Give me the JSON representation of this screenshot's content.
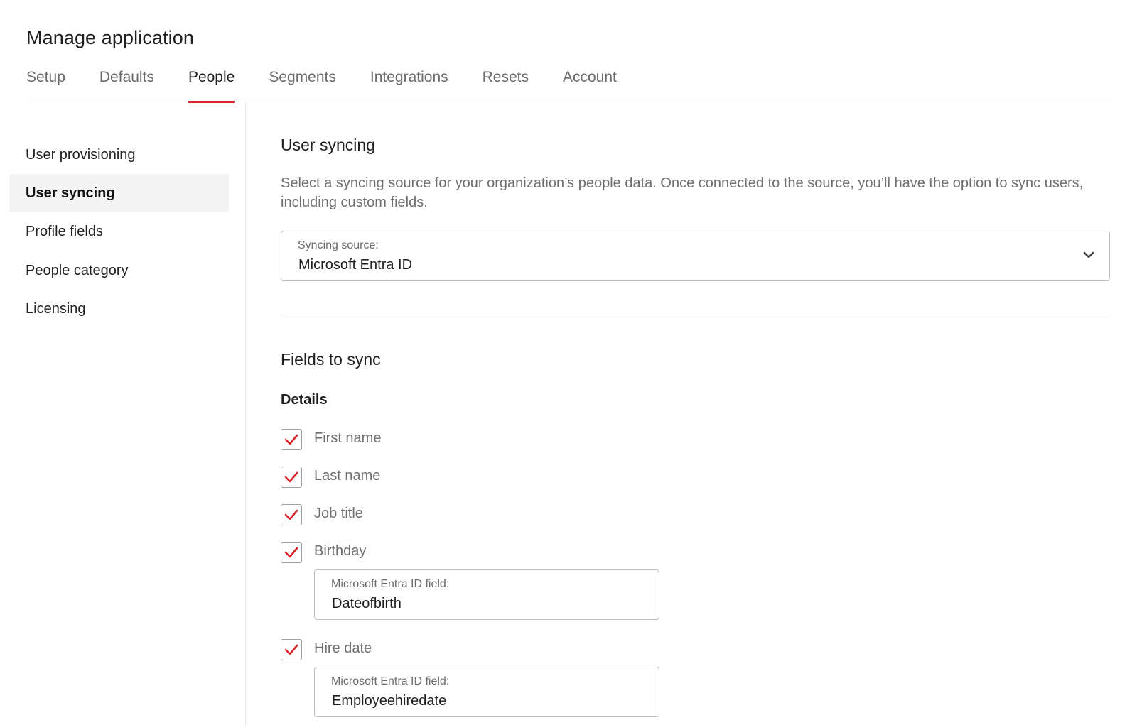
{
  "page": {
    "title": "Manage application"
  },
  "tabs": [
    {
      "label": "Setup"
    },
    {
      "label": "Defaults"
    },
    {
      "label": "People"
    },
    {
      "label": "Segments"
    },
    {
      "label": "Integrations"
    },
    {
      "label": "Resets"
    },
    {
      "label": "Account"
    }
  ],
  "active_tab": "People",
  "sidebar": {
    "items": [
      {
        "label": "User provisioning"
      },
      {
        "label": "User syncing"
      },
      {
        "label": "Profile fields"
      },
      {
        "label": "People category"
      },
      {
        "label": "Licensing"
      }
    ],
    "active_item": "User syncing"
  },
  "user_syncing": {
    "title": "User syncing",
    "description": "Select a syncing source for your organization’s people data. Once connected to the source, you’ll have the option to sync users, including custom fields.",
    "source_label": "Syncing source:",
    "source_value": "Microsoft Entra ID",
    "dropdown_icon": "chevron-down-icon"
  },
  "fields_to_sync": {
    "title": "Fields to sync",
    "details_heading": "Details",
    "fields": [
      {
        "label": "First name",
        "checked": true
      },
      {
        "label": "Last name",
        "checked": true
      },
      {
        "label": "Job title",
        "checked": true
      },
      {
        "label": "Birthday",
        "checked": true,
        "mapping_label": "Microsoft Entra ID field:",
        "mapping_value": "Dateofbirth"
      },
      {
        "label": "Hire date",
        "checked": true,
        "mapping_label": "Microsoft Entra ID field:",
        "mapping_value": "Employeehiredate"
      }
    ]
  },
  "colors": {
    "accent": "#d9262c",
    "text_primary": "#1f1f1f",
    "text_secondary": "#6e6e6e",
    "border": "#bdbdbd",
    "active_bg": "#f4f4f4"
  }
}
